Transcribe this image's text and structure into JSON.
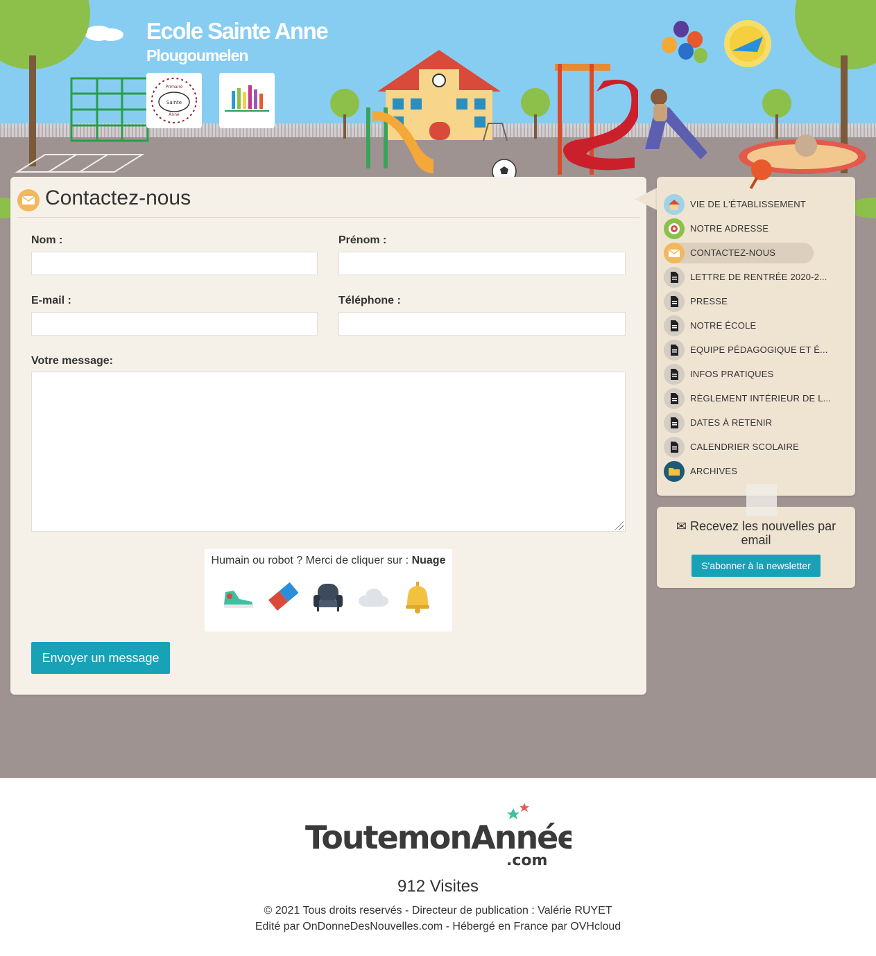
{
  "header": {
    "site_title": "Ecole Sainte Anne",
    "site_subtitle": "Plougoumelen",
    "logo1_text": [
      "Primaire",
      "Sainte",
      "Anne"
    ]
  },
  "contact": {
    "title": "Contactez-nous",
    "icon": "envelope-icon",
    "fields": {
      "nom_label": "Nom :",
      "prenom_label": "Prénom :",
      "email_label": "E-mail :",
      "telephone_label": "Téléphone :",
      "message_label": "Votre message:"
    },
    "captcha": {
      "prompt": "Humain ou robot ? Merci de cliquer sur :",
      "answer": "Nuage",
      "options": [
        "sneaker-icon",
        "eraser-icon",
        "armchair-icon",
        "cloud-icon",
        "bell-icon"
      ]
    },
    "submit_label": "Envoyer un message"
  },
  "sidebar": {
    "items": [
      {
        "label": "VIE DE L'ÉTABLISSEMENT",
        "icon": "school-icon",
        "active": false
      },
      {
        "label": "NOTRE ADRESSE",
        "icon": "target-icon",
        "active": false
      },
      {
        "label": "CONTACTEZ-NOUS",
        "icon": "envelope-icon",
        "active": true
      },
      {
        "label": "LETTRE DE RENTRÉE 2020-2...",
        "icon": "document-icon",
        "active": false
      },
      {
        "label": "PRESSE",
        "icon": "document-icon",
        "active": false
      },
      {
        "label": "NOTRE ÉCOLE",
        "icon": "document-icon",
        "active": false
      },
      {
        "label": "EQUIPE PÉDAGOGIQUE ET É...",
        "icon": "document-icon",
        "active": false
      },
      {
        "label": "INFOS PRATIQUES",
        "icon": "document-icon",
        "active": false
      },
      {
        "label": "RÈGLEMENT INTÉRIEUR DE L...",
        "icon": "document-icon",
        "active": false
      },
      {
        "label": "DATES À RETENIR",
        "icon": "document-icon",
        "active": false
      },
      {
        "label": "CALENDRIER SCOLAIRE",
        "icon": "document-icon",
        "active": false
      },
      {
        "label": "ARCHIVES",
        "icon": "folder-icon",
        "active": false
      }
    ],
    "newsletter": {
      "text": "Recevez les nouvelles par email",
      "button_label": "S'abonner à la newsletter"
    }
  },
  "footer": {
    "brand": "ToutemonAnnée.com",
    "visits": "912 Visites",
    "copyright": "© 2021 Tous droits reservés - Directeur de publication : Valérie RUYET",
    "credits": "Edité par OnDonneDesNouvelles.com - Hébergé en France par OVHcloud"
  },
  "colors": {
    "accent": "#17a2b8",
    "sky": "#87cdf2",
    "ground": "#9f9392",
    "panel": "#f6f1e8"
  }
}
